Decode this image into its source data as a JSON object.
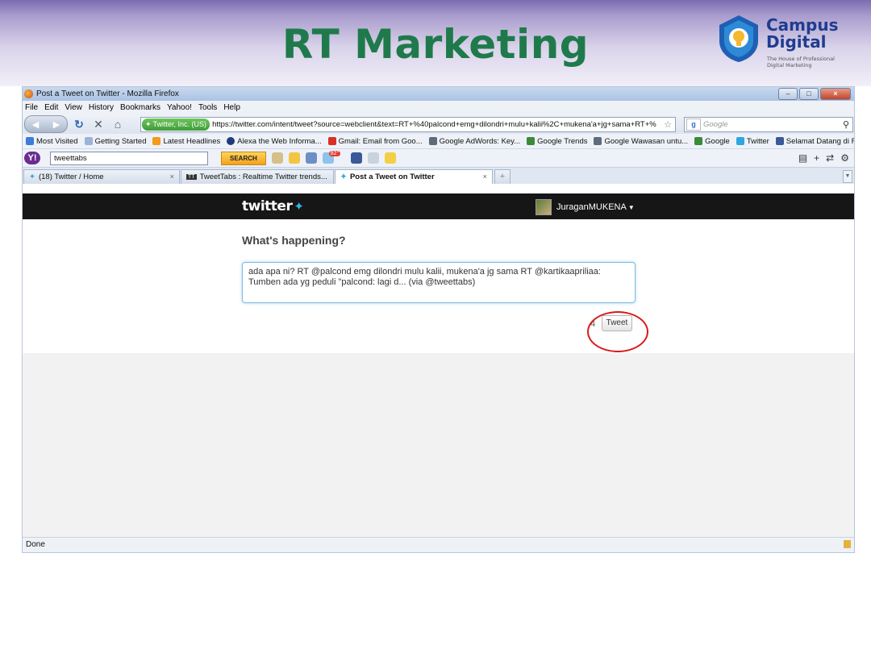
{
  "slide": {
    "title": "RT Marketing",
    "logo": {
      "name_line1": "Campus",
      "name_line2": "Digital",
      "tagline": "The House of Professional Digital Marketing"
    }
  },
  "window": {
    "title": "Post a Tweet on Twitter - Mozilla Firefox",
    "menu": [
      "File",
      "Edit",
      "View",
      "History",
      "Bookmarks",
      "Yahoo!",
      "Tools",
      "Help"
    ]
  },
  "navbar": {
    "site_identity": "Twitter, Inc. (US)",
    "url": "https://twitter.com/intent/tweet?source=webclient&text=RT+%40palcond+emg+dilondri+mulu+kalii%2C+mukena'a+jg+sama+RT+%",
    "search_placeholder": "Google"
  },
  "bookmarks": [
    {
      "label": "Most Visited",
      "color": "#3b7dd8"
    },
    {
      "label": "Getting Started",
      "color": "#9ab3d6"
    },
    {
      "label": "Latest Headlines",
      "color": "#f29b1d"
    },
    {
      "label": "Alexa the Web Informa...",
      "color": "#1d3d7a"
    },
    {
      "label": "Gmail: Email from Goo...",
      "color": "#d93025"
    },
    {
      "label": "Google AdWords: Key...",
      "color": "#5f6b7a"
    },
    {
      "label": "Google Trends",
      "color": "#3a8a3a"
    },
    {
      "label": "Google Wawasan untu...",
      "color": "#5f6b7a"
    },
    {
      "label": "Google",
      "color": "#3a8a3a"
    },
    {
      "label": "Twitter",
      "color": "#2fa6e0"
    },
    {
      "label": "Selamat Datang di Fac...",
      "color": "#3b5998"
    }
  ],
  "bookmarks_more": "»",
  "yahoo_toolbar": {
    "search_value": "tweettabs",
    "search_button": "SEARCH",
    "badge": "82°"
  },
  "tabs": [
    {
      "label": "(18) Twitter / Home"
    },
    {
      "label": "TweetTabs : Realtime Twitter trends..."
    },
    {
      "label": "Post a Tweet on Twitter"
    }
  ],
  "tab_new": "+",
  "twitter": {
    "logo_text": "twitter",
    "username": "JuraganMUKENA",
    "heading": "What's happening?",
    "tweet_text": "ada apa ni? RT @palcond emg dilondri mulu kalii, mukena'a jg sama RT @kartikaapriliaa: Tumben ada yg peduli \"palcond: lagi d... (via @tweettabs)",
    "char_counter": "4",
    "tweet_button": "Tweet"
  },
  "status": {
    "text": "Done"
  },
  "colors": {
    "title_green": "#1f7a4b",
    "twitter_bar": "#161616",
    "highlight_ring": "#d8191b"
  }
}
